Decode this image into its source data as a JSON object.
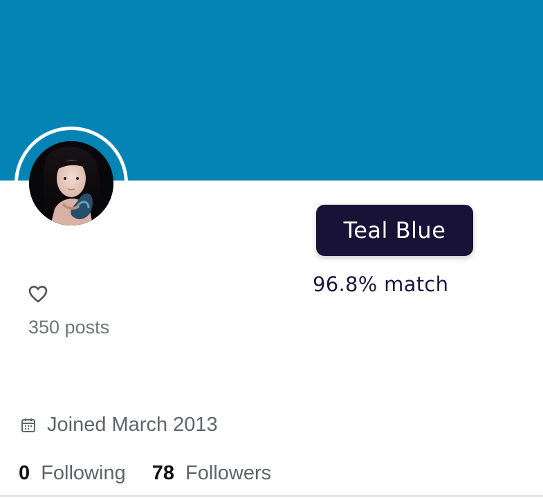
{
  "colors": {
    "banner": "#0483b5",
    "chip_background": "#181236",
    "chip_text": "#ffffff",
    "match_text": "#1b1740",
    "secondary_text": "#5f6469",
    "primary_text": "#111111"
  },
  "profile": {
    "avatar_icon": "profile-photo"
  },
  "color_match": {
    "name": "Teal Blue",
    "match": "96.8% match"
  },
  "likes": {
    "icon": "heart-icon",
    "posts": "350 posts"
  },
  "joined": {
    "icon": "calendar-icon",
    "text": "Joined March 2013"
  },
  "stats": {
    "following_count": "0",
    "following_label": "Following",
    "followers_count": "78",
    "followers_label": "Followers"
  }
}
